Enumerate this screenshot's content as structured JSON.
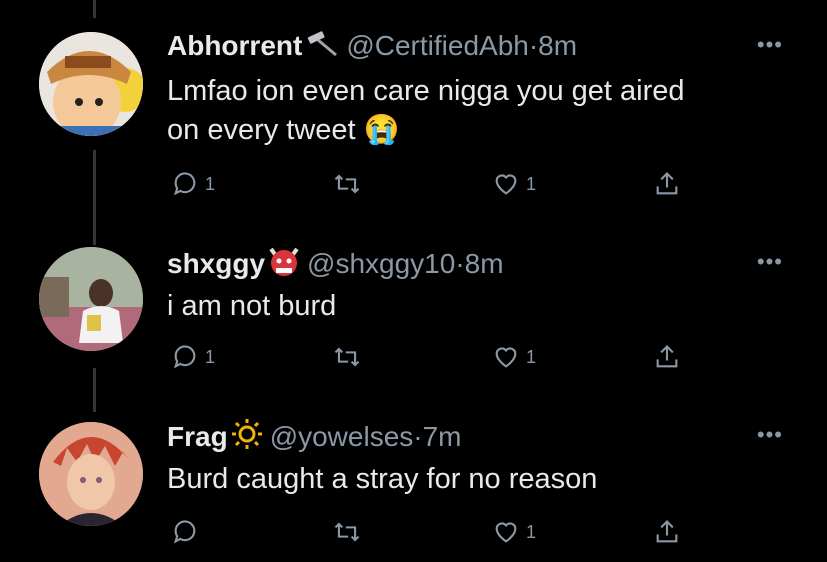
{
  "tweets": [
    {
      "display_name": "Abhorrent",
      "badge_icon": "hammer-icon",
      "handle": "@CertifiedAbh",
      "time": "8m",
      "text_lines": [
        "Lmfao ion even care nigga you get aired",
        "on every tweet"
      ],
      "emoji": "😭",
      "reply_count": "1",
      "retweet_count": "",
      "like_count": "1"
    },
    {
      "display_name": "shxggy",
      "badge_icon": "ogre-icon",
      "handle": "@shxggy10",
      "time": "8m",
      "text_lines": [
        "i am not burd"
      ],
      "reply_count": "1",
      "retweet_count": "",
      "like_count": "1"
    },
    {
      "display_name": "Frag",
      "badge_icon": "sun-icon",
      "handle": "@yowelses",
      "time": "7m",
      "text_lines": [
        "Burd caught a stray for no reason"
      ],
      "reply_count": "",
      "retweet_count": "",
      "like_count": "1"
    }
  ],
  "separator": "·",
  "more_label": "•••",
  "colors": {
    "background": "#000000",
    "text": "#e7e9ea",
    "muted": "#8b98a5",
    "thread": "#333639"
  }
}
